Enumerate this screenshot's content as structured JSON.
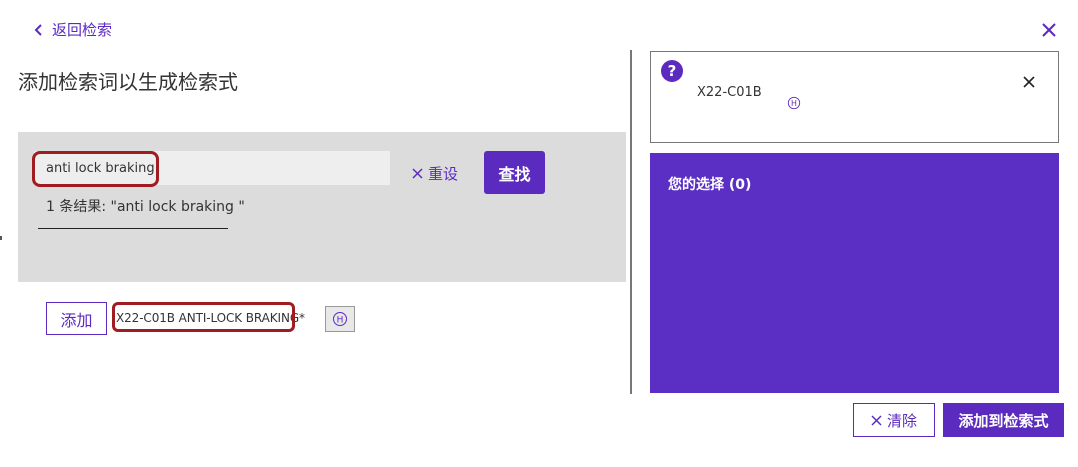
{
  "header": {
    "back_label": "返回检索",
    "title": "添加检索词以生成检索式"
  },
  "search": {
    "value": "anti lock braking",
    "reset_label": "重设",
    "search_label": "查找",
    "result_text": "1 条结果: \"anti lock braking \""
  },
  "result": {
    "add_label": "添加",
    "code_text": "X22-C01B ANTI-LOCK BRAKING*",
    "h_icon": "Ⓗ"
  },
  "info_box": {
    "code": "X22-C01B",
    "h_icon": "Ⓗ"
  },
  "selection": {
    "title": "您的选择 (0)"
  },
  "footer": {
    "clear_label": "清除",
    "add_to_query_label": "添加到检索式"
  },
  "colors": {
    "accent": "#5b2bbf",
    "panel": "#5b2fc4",
    "highlight": "#a01c22",
    "search_bg": "#dcdcdc"
  },
  "icons": [
    "chevron-left-icon",
    "close-icon",
    "help-icon",
    "h-icon"
  ]
}
